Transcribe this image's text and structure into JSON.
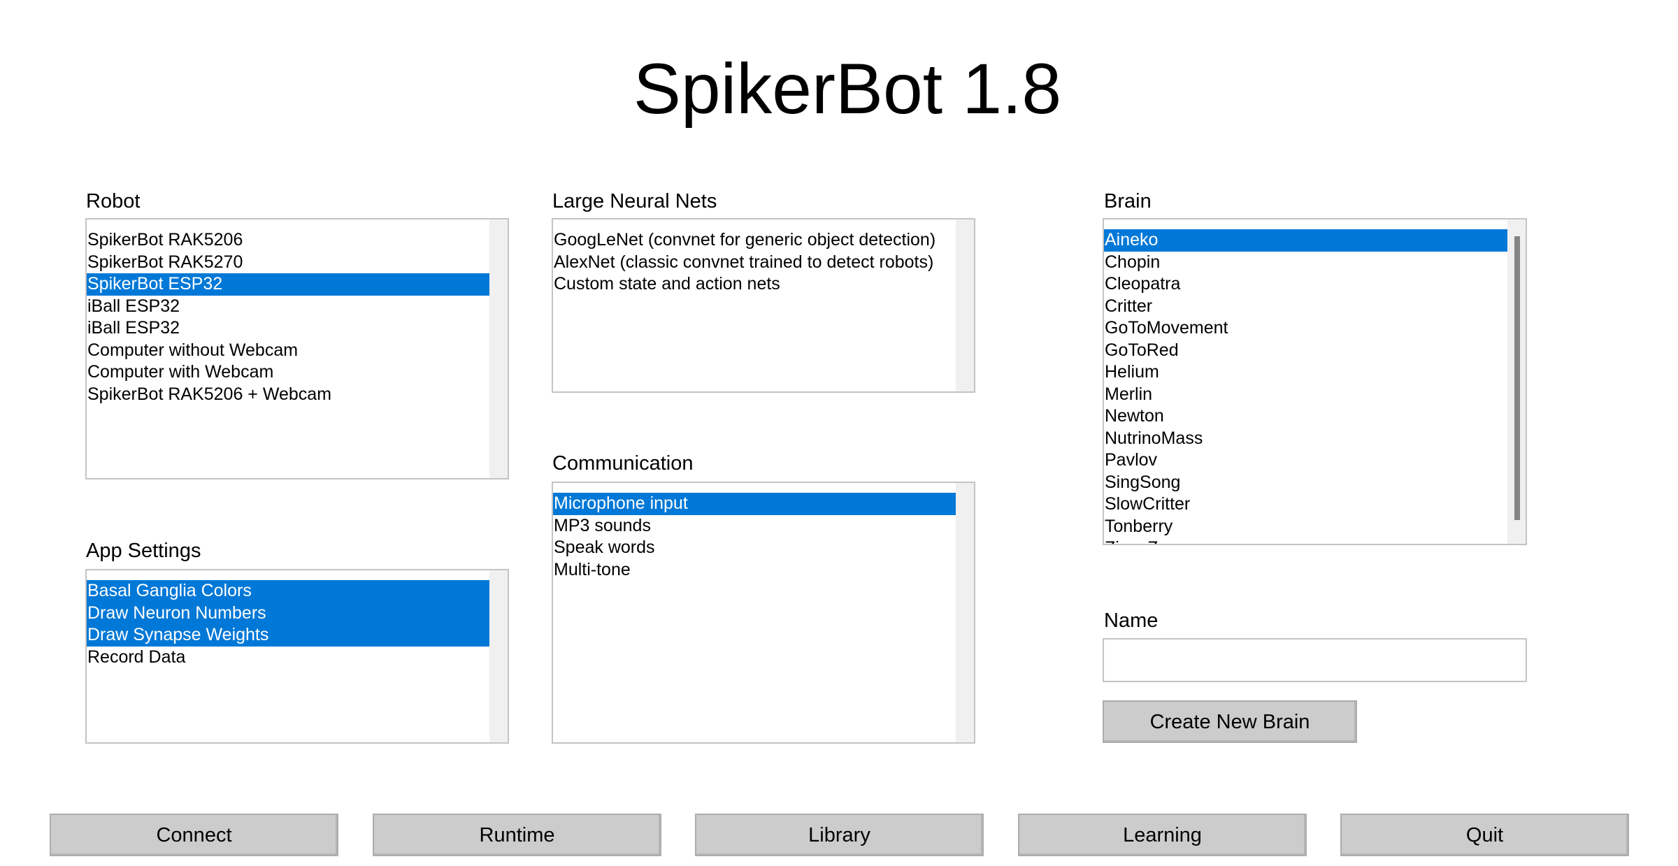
{
  "app": {
    "title": "SpikerBot 1.8"
  },
  "robot": {
    "label": "Robot",
    "items": [
      "SpikerBot RAK5206",
      "SpikerBot RAK5270",
      "SpikerBot ESP32",
      "iBall ESP32",
      "iBall ESP32",
      "Computer without Webcam",
      "Computer with Webcam",
      "SpikerBot RAK5206 + Webcam"
    ],
    "selected": [
      "SpikerBot ESP32"
    ]
  },
  "neural_nets": {
    "label": "Large Neural Nets",
    "items": [
      "GoogLeNet (convnet for generic object detection)",
      "AlexNet (classic convnet trained to detect robots)",
      "Custom state and action nets"
    ],
    "selected": []
  },
  "brain": {
    "label": "Brain",
    "items": [
      "Aineko",
      "Chopin",
      "Cleopatra",
      "Critter",
      "GoToMovement",
      "GoToRed",
      "Helium",
      "Merlin",
      "Newton",
      "NutrinoMass",
      "Pavlov",
      "SingSong",
      "SlowCritter",
      "Tonberry",
      "ZiggyZag"
    ],
    "selected": [
      "Aineko"
    ]
  },
  "app_settings": {
    "label": "App Settings",
    "items": [
      "Basal Ganglia Colors",
      "Draw Neuron Numbers",
      "Draw Synapse Weights",
      "Record Data"
    ],
    "selected": [
      "Basal Ganglia Colors",
      "Draw Neuron Numbers",
      "Draw Synapse Weights"
    ]
  },
  "communication": {
    "label": "Communication",
    "items": [
      "Microphone input",
      "MP3 sounds",
      "Speak words",
      "Multi-tone"
    ],
    "selected": [
      "Microphone input"
    ]
  },
  "name": {
    "label": "Name",
    "value": "",
    "placeholder": ""
  },
  "create_brain_button": "Create New Brain",
  "nav": {
    "connect": "Connect",
    "runtime": "Runtime",
    "library": "Library",
    "learning": "Learning",
    "quit": "Quit"
  },
  "colors": {
    "selection": "#0078d7",
    "button_face": "#cccccc",
    "list_border": "#c4c4c4",
    "scroll_track": "#f0f0f0",
    "scroll_thumb": "#858585"
  }
}
